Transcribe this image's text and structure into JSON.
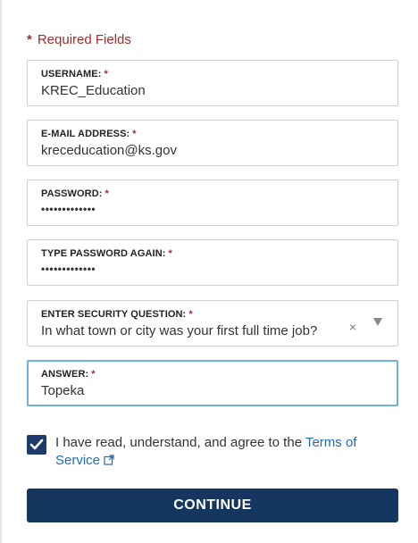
{
  "required_note": {
    "star": "*",
    "text": "Required Fields"
  },
  "fields": {
    "username": {
      "label": "USERNAME:",
      "star": "*",
      "value": "KREC_Education"
    },
    "email": {
      "label": "E-MAIL ADDRESS:",
      "star": "*",
      "value": "kreceducation@ks.gov"
    },
    "password": {
      "label": "PASSWORD:",
      "star": "*",
      "value": "•••••••••••••"
    },
    "password_again": {
      "label": "TYPE PASSWORD AGAIN:",
      "star": "*",
      "value": "•••••••••••••"
    },
    "security_question": {
      "label": "ENTER SECURITY QUESTION:",
      "star": "*",
      "value": "In what town or city was your first full time job?",
      "clear": "×"
    },
    "answer": {
      "label": "ANSWER:",
      "star": "*",
      "value": "Topeka"
    }
  },
  "terms": {
    "checked": true,
    "text_before": "I have read, understand, and agree to the ",
    "link_text_1": "Terms of",
    "link_text_2": "Service",
    "icons": {
      "check": "check-icon",
      "external": "external-link-icon"
    }
  },
  "continue_label": "CONTINUE",
  "colors": {
    "required_red": "#a52a2a",
    "link_blue": "#1e6bb8",
    "button_navy": "#15365e",
    "focus_border": "#6fb0dc"
  }
}
